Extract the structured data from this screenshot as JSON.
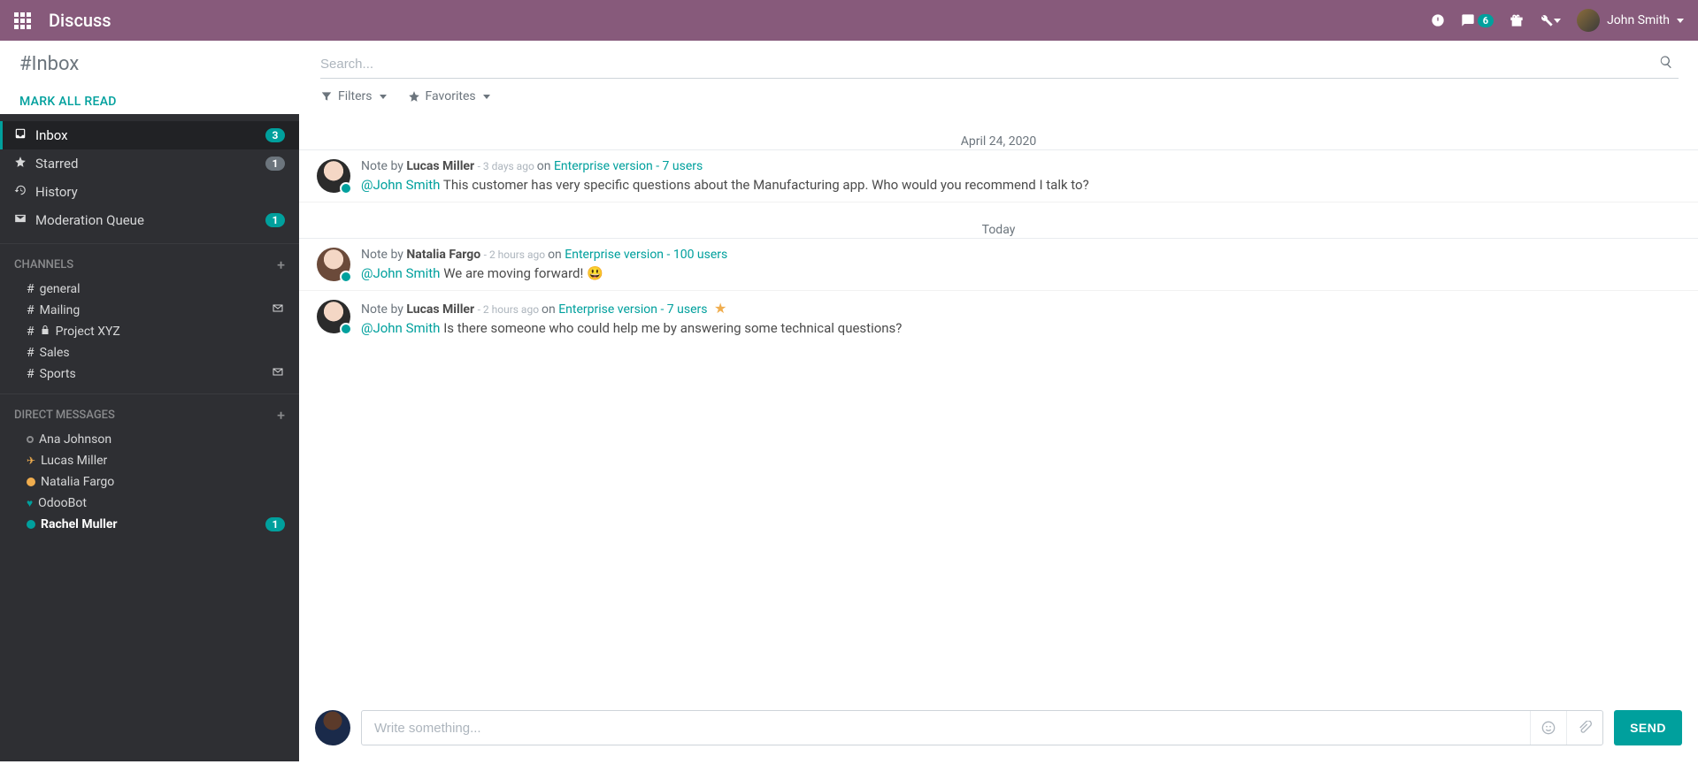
{
  "header": {
    "app_title": "Discuss",
    "notification_count": "6",
    "user_name": "John Smith"
  },
  "subheader": {
    "title": "#Inbox",
    "mark_all": "MARK ALL READ",
    "search_placeholder": "Search...",
    "filters_label": "Filters",
    "favorites_label": "Favorites"
  },
  "sidebar": {
    "main": [
      {
        "label": "Inbox",
        "badge": "3",
        "badge_style": "teal",
        "icon": "inbox",
        "active": true
      },
      {
        "label": "Starred",
        "badge": "1",
        "badge_style": "grey",
        "icon": "star"
      },
      {
        "label": "History",
        "icon": "history"
      },
      {
        "label": "Moderation Queue",
        "badge": "1",
        "badge_style": "teal",
        "icon": "envelope"
      }
    ],
    "channels_title": "CHANNELS",
    "channels": [
      {
        "label": "general",
        "prefix": "#"
      },
      {
        "label": "Mailing",
        "prefix": "#",
        "trailing_icon": "mail"
      },
      {
        "label": "Project XYZ",
        "prefix": "#",
        "lock": true
      },
      {
        "label": "Sales",
        "prefix": "#"
      },
      {
        "label": "Sports",
        "prefix": "#",
        "trailing_icon": "mail"
      }
    ],
    "dm_title": "DIRECT MESSAGES",
    "dms": [
      {
        "label": "Ana Johnson",
        "status": "offline"
      },
      {
        "label": "Lucas Miller",
        "status": "plane"
      },
      {
        "label": "Natalia Fargo",
        "status": "away"
      },
      {
        "label": "OdooBot",
        "status": "heart"
      },
      {
        "label": "Rachel Muller",
        "status": "teal",
        "bold": true,
        "badge": "1"
      }
    ]
  },
  "thread": {
    "groups": [
      {
        "date": "April 24, 2020",
        "messages": [
          {
            "note_by": "Note by",
            "author": "Lucas Miller",
            "avatar": "lucas",
            "time": "- 3 days ago",
            "on": "on",
            "record": "Enterprise version - 7 users",
            "mention": "@John Smith",
            "text": "This customer has very specific questions about the Manufacturing app. Who would you recommend I talk to?"
          }
        ]
      },
      {
        "date": "Today",
        "messages": [
          {
            "note_by": "Note by",
            "author": "Natalia Fargo",
            "avatar": "natalia",
            "time": "- 2 hours ago",
            "on": "on",
            "record": "Enterprise version - 100 users",
            "mention": "@John Smith",
            "text": "We are moving forward! 😃"
          },
          {
            "note_by": "Note by",
            "author": "Lucas Miller",
            "avatar": "lucas",
            "time": "- 2 hours ago",
            "on": "on",
            "record": "Enterprise version - 7 users",
            "starred": true,
            "mention": "@John Smith",
            "text": "Is there someone who could help me by answering some technical questions?"
          }
        ]
      }
    ]
  },
  "composer": {
    "placeholder": "Write something...",
    "send_label": "SEND"
  }
}
